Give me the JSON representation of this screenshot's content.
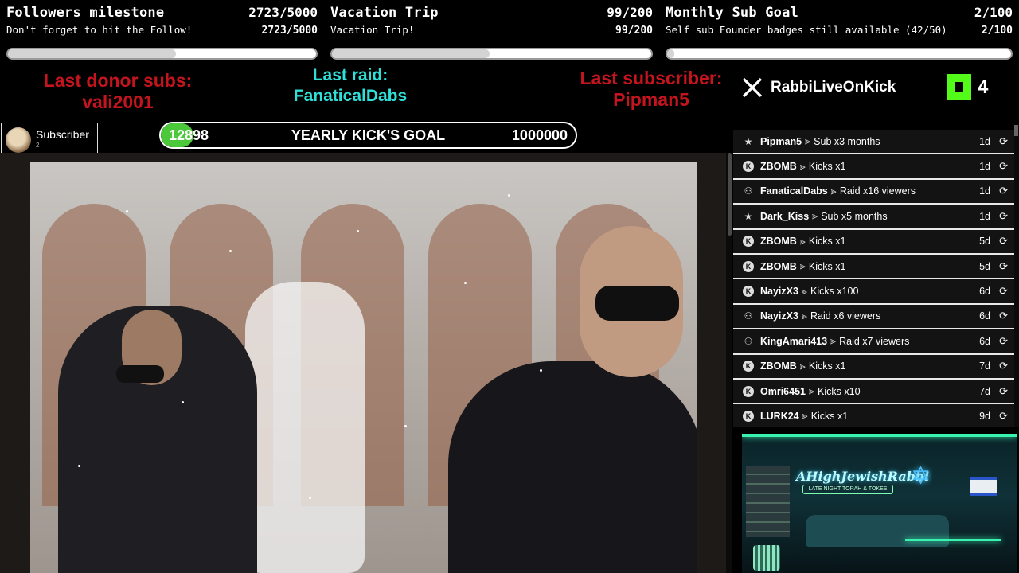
{
  "goals": [
    {
      "title": "Followers milestone",
      "count": "2723/5000",
      "subtitle": "Don't forget to hit the Follow!",
      "sub_count": "2723/5000",
      "progress": 0.5446
    },
    {
      "title": "Vacation Trip",
      "count": "99/200",
      "subtitle": "Vacation Trip!",
      "sub_count": "99/200",
      "progress": 0.495
    },
    {
      "title": "Monthly Sub Goal",
      "count": "2/100",
      "subtitle": "Self sub Founder badges still available (42/50)",
      "sub_count": "2/100",
      "progress": 0.02
    }
  ],
  "last_events": {
    "donor_label": "Last donor subs:",
    "donor_name": "vali2001",
    "raid_label": "Last raid:",
    "raid_name": "FanaticalDabs",
    "subscriber_label": "Last subscriber:",
    "subscriber_name": "Pipman5"
  },
  "social": {
    "x_handle": "RabbiLiveOnKick",
    "kick_count": "4"
  },
  "subscriber_badge": {
    "label": "Subscriber",
    "count": "2"
  },
  "yearly_goal": {
    "current": "12898",
    "title": "YEARLY KICK'S GOAL",
    "target": "1000000",
    "progress": 0.012898
  },
  "events": [
    {
      "icon": "star-icon",
      "user": "Pipman5",
      "action": "Sub x3 months",
      "when": "1d"
    },
    {
      "icon": "kick-icon",
      "user": "ZBOMB",
      "action": "Kicks x1",
      "when": "1d"
    },
    {
      "icon": "raid-icon",
      "user": "FanaticalDabs",
      "action": "Raid x16 viewers",
      "when": "1d"
    },
    {
      "icon": "star-icon",
      "user": "Dark_Kiss",
      "action": "Sub x5 months",
      "when": "1d"
    },
    {
      "icon": "kick-icon",
      "user": "ZBOMB",
      "action": "Kicks x1",
      "when": "5d"
    },
    {
      "icon": "kick-icon",
      "user": "ZBOMB",
      "action": "Kicks x1",
      "when": "5d"
    },
    {
      "icon": "kick-icon",
      "user": "NayizX3",
      "action": "Kicks x100",
      "when": "6d"
    },
    {
      "icon": "raid-icon",
      "user": "NayizX3",
      "action": "Raid x6 viewers",
      "when": "6d"
    },
    {
      "icon": "raid-icon",
      "user": "KingAmari413",
      "action": "Raid x7 viewers",
      "when": "6d"
    },
    {
      "icon": "kick-icon",
      "user": "ZBOMB",
      "action": "Kicks x1",
      "when": "7d"
    },
    {
      "icon": "kick-icon",
      "user": "Omri6451",
      "action": "Kicks x10",
      "when": "7d"
    },
    {
      "icon": "kick-icon",
      "user": "LURK24",
      "action": "Kicks x1",
      "when": "9d"
    }
  ],
  "event_separator": "⪢",
  "rabbi_panel": {
    "brand": "AHighJewishRabbi",
    "tagline": "LATE NIGHT TORAH & TOKES"
  },
  "colors": {
    "kick_green": "#53fc18",
    "last_red": "#c4141d",
    "last_cyan": "#2ee0d8",
    "neon": "#3af2b0"
  }
}
